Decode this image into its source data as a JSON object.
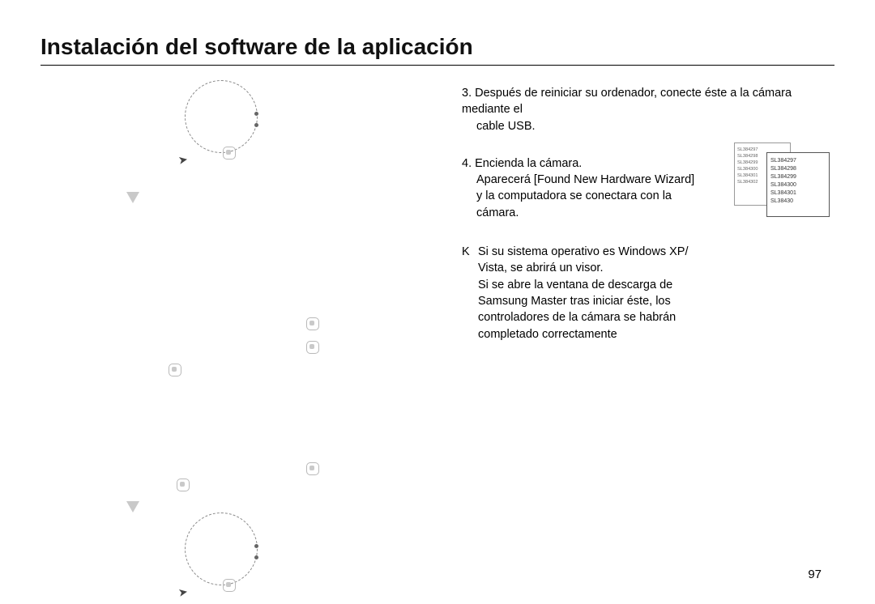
{
  "title": "Instalación del software de la aplicación",
  "step3": {
    "head": "3. Después de reiniciar su ordenador, conecte éste a la cámara mediante el",
    "sub": "cable USB."
  },
  "step4": {
    "head": "4. Encienda la cámara.",
    "line1": "Aparecerá [Found New Hardware Wizard]",
    "line2": "y la computadora se conectara con la",
    "line3": "cámara."
  },
  "note": {
    "marker": "K",
    "line1": "Si su sistema operativo es Windows XP/",
    "line2": "Vista, se abrirá un visor.",
    "line3": "Si se abre la ventana de descarga de",
    "line4": "Samsung Master tras iniciar éste, los",
    "line5": "controladores de la cámara se habrán",
    "line6": "completado correctamente"
  },
  "figure": {
    "back_labels": [
      "SL384297",
      "SL384298",
      "SL384299",
      "SL384300",
      "SL384301",
      "SL384302"
    ],
    "front_labels": [
      "SL384297",
      "SL384298",
      "SL384299",
      "SL384300",
      "SL384301",
      "SL38430"
    ]
  },
  "page_number": "97"
}
